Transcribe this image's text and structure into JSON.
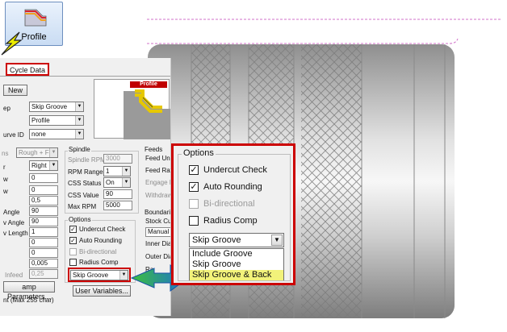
{
  "toolbar": {
    "profile_label": "Profile"
  },
  "dialog": {
    "tab_label": "Cycle Data",
    "top_button": "New",
    "row_labels": [
      "ep",
      "urve ID"
    ],
    "step_value": "Skip Groove",
    "type_value": "Profile",
    "curve_value": "none",
    "preview_title": "Profile",
    "left_fields": {
      "ns_label": "ns",
      "ns_value": "Rough + Fin",
      "r_label": "r",
      "r_value": "Right",
      "w1_label": "w",
      "w1_value": "0",
      "w2_label": "w",
      "w2_value": "0",
      "w3_value": "0,5",
      "angle_label": "Angle",
      "angle_value": "90",
      "vangle_label": "v Angle",
      "vangle_value": "90",
      "vlen_label": "v Length",
      "vlen_value": "1",
      "f1_value": "0",
      "f2_value": "0",
      "f3_value": "0,005",
      "infeed_label": "Infeed",
      "infeed_value": "0,25"
    },
    "spindle": {
      "title": "Spindle",
      "rpm_label": "Spindle RPM",
      "rpm_value": "3000",
      "range_label": "RPM Range",
      "range_value": "1",
      "css_status_label": "CSS Status",
      "css_status_value": "On",
      "css_value_label": "CSS Value",
      "css_value": "90",
      "max_rpm_label": "Max RPM",
      "max_rpm_value": "5000"
    },
    "feeds": {
      "title": "Feeds",
      "l1": "Feed Units",
      "l2": "Feed Rate",
      "l3": "Engage Fe",
      "l4": "Withdraw"
    },
    "options_small": {
      "title": "Options",
      "undercut": "Undercut Check",
      "autoround": "Auto Rounding",
      "bidir": "Bi-directional",
      "radcomp": "Radius Comp",
      "value": "Skip Groove"
    },
    "boundaries": {
      "title": "Boundaries",
      "stock_label": "Stock Curv",
      "stock_value": "Manual",
      "inner": "Inner Dia",
      "outer": "Outer Dia",
      "ra": "Ra"
    },
    "stamp_button": "amp Parameters...",
    "user_vars_button": "User Variables...",
    "footer_text": "nt  (Max 255 char)"
  },
  "options_panel": {
    "title": "Options",
    "undercut_label": "Undercut Check",
    "autoround_label": "Auto Rounding",
    "bidir_label": "Bi-directional",
    "radcomp_label": "Radius Comp",
    "selected": "Skip Groove",
    "items": [
      "Include Groove",
      "Skip Groove",
      "Skip Groove & Back"
    ]
  },
  "colors": {
    "highlight_red": "#cc0000",
    "arrow_blue": "#1a6fd6",
    "arrow_green": "#2fb32f",
    "selection_yellow": "#f2f27a"
  }
}
